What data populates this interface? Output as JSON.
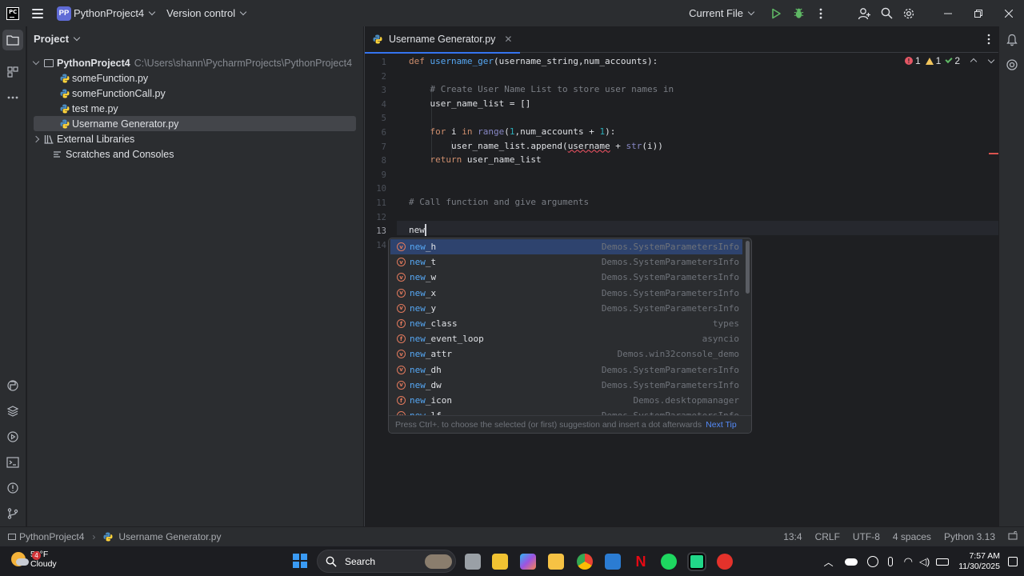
{
  "titlebar": {
    "project_badge": "PP",
    "project_name": "PythonProject4",
    "vcs": "Version control",
    "run_config": "Current File"
  },
  "project_panel": {
    "title": "Project",
    "root_name": "PythonProject4",
    "root_path": "C:\\Users\\shann\\PycharmProjects\\PythonProject4",
    "files": [
      "someFunction.py",
      "someFunctionCall.py",
      "test me.py",
      "Username Generator.py"
    ],
    "external_libraries": "External Libraries",
    "scratches": "Scratches and Consoles"
  },
  "editor": {
    "tab_label": "Username Generator.py",
    "inspections": {
      "errors": "1",
      "warnings": "1",
      "ok": "2"
    },
    "line_numbers": [
      "1",
      "2",
      "3",
      "4",
      "5",
      "6",
      "7",
      "8",
      "9",
      "10",
      "11",
      "12",
      "13",
      "14"
    ],
    "current_line": "13",
    "lines": [
      [
        {
          "t": "def ",
          "c": "kw"
        },
        {
          "t": "username_ger",
          "c": "fn"
        },
        {
          "t": "(username_string,num_accounts):",
          "c": ""
        }
      ],
      [],
      [
        {
          "t": "    # Create User Name List to store user names in",
          "c": "cm"
        }
      ],
      [
        {
          "t": "    user_name_list = []",
          "c": ""
        }
      ],
      [],
      [
        {
          "t": "    ",
          "c": ""
        },
        {
          "t": "for ",
          "c": "kw"
        },
        {
          "t": "i ",
          "c": ""
        },
        {
          "t": "in ",
          "c": "kw"
        },
        {
          "t": "range",
          "c": "bi"
        },
        {
          "t": "(",
          "c": ""
        },
        {
          "t": "1",
          "c": "num"
        },
        {
          "t": ",num_accounts + ",
          "c": ""
        },
        {
          "t": "1",
          "c": "num"
        },
        {
          "t": "):",
          "c": ""
        }
      ],
      [
        {
          "t": "        user_name_list.append(",
          "c": ""
        },
        {
          "t": "username",
          "c": "err"
        },
        {
          "t": " + ",
          "c": ""
        },
        {
          "t": "str",
          "c": "bi"
        },
        {
          "t": "(i))",
          "c": ""
        }
      ],
      [
        {
          "t": "    ",
          "c": ""
        },
        {
          "t": "return ",
          "c": "kw"
        },
        {
          "t": "user_name_list",
          "c": ""
        }
      ],
      [],
      [],
      [
        {
          "t": "# Call function and give arguments",
          "c": "cm"
        }
      ],
      [],
      [
        {
          "t": "new",
          "c": ""
        }
      ],
      []
    ]
  },
  "completion": {
    "typed": "new",
    "items": [
      {
        "icon": "v",
        "name": "new_h",
        "source": "Demos.SystemParametersInfo"
      },
      {
        "icon": "v",
        "name": "new_t",
        "source": "Demos.SystemParametersInfo"
      },
      {
        "icon": "v",
        "name": "new_w",
        "source": "Demos.SystemParametersInfo"
      },
      {
        "icon": "v",
        "name": "new_x",
        "source": "Demos.SystemParametersInfo"
      },
      {
        "icon": "v",
        "name": "new_y",
        "source": "Demos.SystemParametersInfo"
      },
      {
        "icon": "f",
        "name": "new_class",
        "source": "types"
      },
      {
        "icon": "f",
        "name": "new_event_loop",
        "source": "asyncio"
      },
      {
        "icon": "v",
        "name": "new_attr",
        "source": "Demos.win32console_demo"
      },
      {
        "icon": "v",
        "name": "new_dh",
        "source": "Demos.SystemParametersInfo"
      },
      {
        "icon": "v",
        "name": "new_dw",
        "source": "Demos.SystemParametersInfo"
      },
      {
        "icon": "f",
        "name": "new_icon",
        "source": "Demos.desktopmanager"
      },
      {
        "icon": "v",
        "name": "new_lf",
        "source": "Demos.SystemParametersInfo"
      }
    ],
    "footer_text": "Press Ctrl+. to choose the selected (or first) suggestion and insert a dot afterwards",
    "footer_link": "Next Tip"
  },
  "statusbar": {
    "crumb_project": "PythonProject4",
    "crumb_file": "Username Generator.py",
    "position": "13:4",
    "line_sep": "CRLF",
    "encoding": "UTF-8",
    "indent": "4 spaces",
    "interpreter": "Python 3.13"
  },
  "taskbar": {
    "weather_badge": "4",
    "temperature": "52°F",
    "condition": "Cloudy",
    "search": "Search",
    "time": "7:57 AM",
    "date": "11/30/2025"
  },
  "colors": {
    "accent": "#3574f0",
    "keyword": "#cf8e6d",
    "function": "#56a8f5",
    "comment": "#7a7e85",
    "number": "#2aacb8",
    "error": "#f75464"
  }
}
